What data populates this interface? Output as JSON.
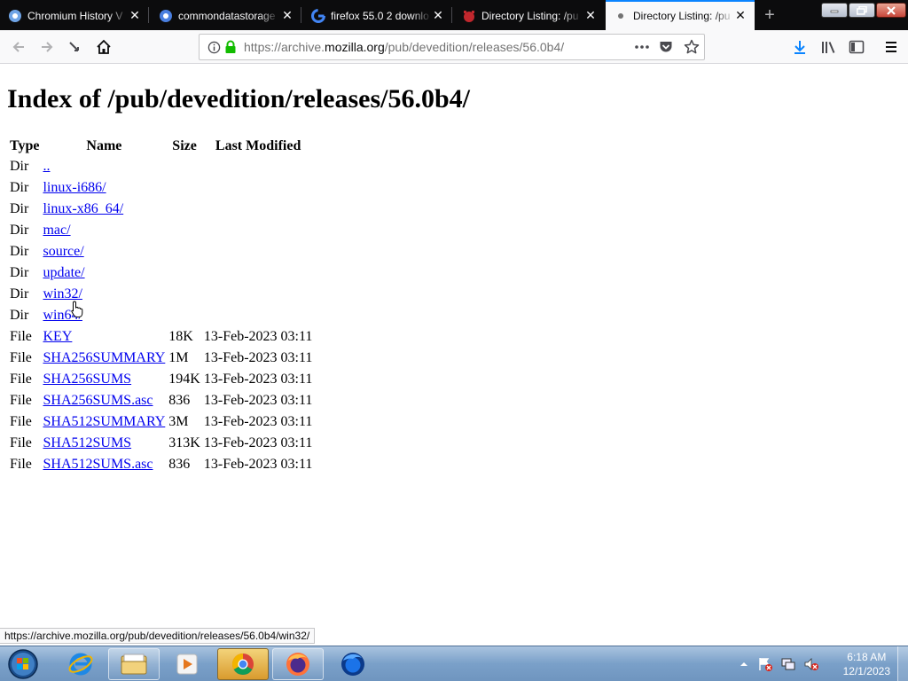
{
  "browser": {
    "tabs": [
      {
        "title": "Chromium History V",
        "favicon": "globe-icon"
      },
      {
        "title": "commondatastorage",
        "favicon": "globe-icon"
      },
      {
        "title": "firefox 55.0 2 downlo",
        "favicon": "google-icon"
      },
      {
        "title": "Directory Listing: /pu",
        "favicon": "bug-icon"
      },
      {
        "title": "Directory Listing: /pu",
        "favicon": "globe-icon",
        "active": true
      }
    ],
    "url": {
      "prefix": "https://archive.",
      "host": "mozilla.org",
      "path": "/pub/devedition/releases/56.0b4/"
    }
  },
  "page": {
    "heading": "Index of /pub/devedition/releases/56.0b4/",
    "columns": [
      "Type",
      "Name",
      "Size",
      "Last Modified"
    ],
    "rows": [
      {
        "type": "Dir",
        "name": "..",
        "size": "",
        "modified": ""
      },
      {
        "type": "Dir",
        "name": "linux-i686/",
        "size": "",
        "modified": ""
      },
      {
        "type": "Dir",
        "name": "linux-x86_64/",
        "size": "",
        "modified": ""
      },
      {
        "type": "Dir",
        "name": "mac/",
        "size": "",
        "modified": ""
      },
      {
        "type": "Dir",
        "name": "source/",
        "size": "",
        "modified": ""
      },
      {
        "type": "Dir",
        "name": "update/",
        "size": "",
        "modified": ""
      },
      {
        "type": "Dir",
        "name": "win32/",
        "size": "",
        "modified": ""
      },
      {
        "type": "Dir",
        "name": "win64/",
        "size": "",
        "modified": ""
      },
      {
        "type": "File",
        "name": "KEY",
        "size": "18K",
        "modified": "13-Feb-2023 03:11"
      },
      {
        "type": "File",
        "name": "SHA256SUMMARY",
        "size": "1M",
        "modified": "13-Feb-2023 03:11"
      },
      {
        "type": "File",
        "name": "SHA256SUMS",
        "size": "194K",
        "modified": "13-Feb-2023 03:11"
      },
      {
        "type": "File",
        "name": "SHA256SUMS.asc",
        "size": "836",
        "modified": "13-Feb-2023 03:11"
      },
      {
        "type": "File",
        "name": "SHA512SUMMARY",
        "size": "3M",
        "modified": "13-Feb-2023 03:11"
      },
      {
        "type": "File",
        "name": "SHA512SUMS",
        "size": "313K",
        "modified": "13-Feb-2023 03:11"
      },
      {
        "type": "File",
        "name": "SHA512SUMS.asc",
        "size": "836",
        "modified": "13-Feb-2023 03:11"
      }
    ],
    "status_url": "https://archive.mozilla.org/pub/devedition/releases/56.0b4/win32/"
  },
  "taskbar": {
    "apps": [
      "start-orb-icon",
      "internet-explorer-icon",
      "file-explorer-icon",
      "media-player-icon",
      "chrome-icon",
      "firefox-icon",
      "firefox-nightly-icon"
    ],
    "clock": {
      "time": "6:18 AM",
      "date": "12/1/2023"
    }
  },
  "colors": {
    "tab_accent": "#0a84ff",
    "link": "#0000ee",
    "secure_lock": "#12bc00",
    "download_arrow": "#0a84ff"
  }
}
